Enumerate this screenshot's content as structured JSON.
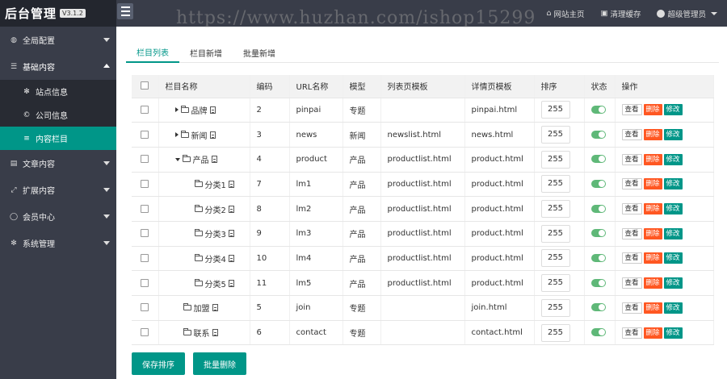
{
  "header": {
    "brand": "后台管理",
    "version": "V3.1.2",
    "links": [
      {
        "icon": "home-icon",
        "label": "网站主页"
      },
      {
        "icon": "trash-icon",
        "label": "清理缓存"
      },
      {
        "icon": "user-icon",
        "label": "超级管理员"
      }
    ]
  },
  "watermark": "https://www.huzhan.com/ishop15299",
  "sidebar": {
    "items": [
      {
        "label": "全局配置",
        "icon": "globe-icon"
      },
      {
        "label": "基础内容",
        "icon": "sliders-icon"
      },
      {
        "label": "文章内容",
        "icon": "file-icon"
      },
      {
        "label": "扩展内容",
        "icon": "expand-icon"
      },
      {
        "label": "会员中心",
        "icon": "user-icon"
      },
      {
        "label": "系统管理",
        "icon": "gear-icon"
      }
    ],
    "subitems": [
      {
        "label": "站点信息",
        "icon": "gear-icon"
      },
      {
        "label": "公司信息",
        "icon": "copyright-icon"
      },
      {
        "label": "内容栏目",
        "icon": "list-icon"
      }
    ]
  },
  "tabs": [
    "栏目列表",
    "栏目新增",
    "批量新增"
  ],
  "table": {
    "headers": [
      "栏目名称",
      "编码",
      "URL名称",
      "模型",
      "列表页模板",
      "详情页模板",
      "排序",
      "状态",
      "操作"
    ],
    "rows": [
      {
        "name": "品牌",
        "code": "2",
        "url": "pinpai",
        "model": "专题",
        "list_tpl": "",
        "detail_tpl": "pinpai.html",
        "sort": "255"
      },
      {
        "name": "新闻",
        "code": "3",
        "url": "news",
        "model": "新闻",
        "list_tpl": "newslist.html",
        "detail_tpl": "news.html",
        "sort": "255"
      },
      {
        "name": "产品",
        "code": "4",
        "url": "product",
        "model": "产品",
        "list_tpl": "productlist.html",
        "detail_tpl": "product.html",
        "sort": "255"
      },
      {
        "name": "分类1",
        "code": "7",
        "url": "lm1",
        "model": "产品",
        "list_tpl": "productlist.html",
        "detail_tpl": "product.html",
        "sort": "255"
      },
      {
        "name": "分类2",
        "code": "8",
        "url": "lm2",
        "model": "产品",
        "list_tpl": "productlist.html",
        "detail_tpl": "product.html",
        "sort": "255"
      },
      {
        "name": "分类3",
        "code": "9",
        "url": "lm3",
        "model": "产品",
        "list_tpl": "productlist.html",
        "detail_tpl": "product.html",
        "sort": "255"
      },
      {
        "name": "分类4",
        "code": "10",
        "url": "lm4",
        "model": "产品",
        "list_tpl": "productlist.html",
        "detail_tpl": "product.html",
        "sort": "255"
      },
      {
        "name": "分类5",
        "code": "11",
        "url": "lm5",
        "model": "产品",
        "list_tpl": "productlist.html",
        "detail_tpl": "product.html",
        "sort": "255"
      },
      {
        "name": "加盟",
        "code": "5",
        "url": "join",
        "model": "专题",
        "list_tpl": "",
        "detail_tpl": "join.html",
        "sort": "255"
      },
      {
        "name": "联系",
        "code": "6",
        "url": "contact",
        "model": "专题",
        "list_tpl": "",
        "detail_tpl": "contact.html",
        "sort": "255"
      }
    ],
    "actions": {
      "view": "查看",
      "delete": "删除",
      "edit": "修改"
    }
  },
  "buttons": {
    "save_sort": "保存排序",
    "batch_delete": "批量删除"
  },
  "colors": {
    "accent": "#009688",
    "danger": "#ff5722",
    "sidebar_bg": "#393d49",
    "toggle_on": "#5fb878"
  }
}
